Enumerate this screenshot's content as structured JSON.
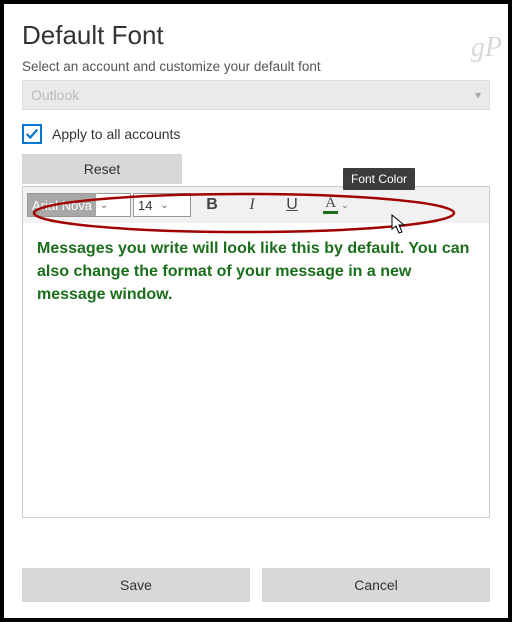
{
  "watermark": "gP",
  "title": "Default Font",
  "subtitle": "Select an account and customize your default font",
  "account_dropdown": {
    "value": "Outlook"
  },
  "apply_all": {
    "checked": true,
    "label": "Apply to all accounts"
  },
  "reset_label": "Reset",
  "toolbar": {
    "font_family": "Arial Nova",
    "font_size": "14",
    "bold_label": "B",
    "italic_label": "I",
    "underline_label": "U",
    "color_label": "A",
    "tooltip": "Font Color"
  },
  "preview_text": "Messages you write will look like this by default. You can also change the format of your message in a new message window.",
  "footer": {
    "save": "Save",
    "cancel": "Cancel"
  }
}
